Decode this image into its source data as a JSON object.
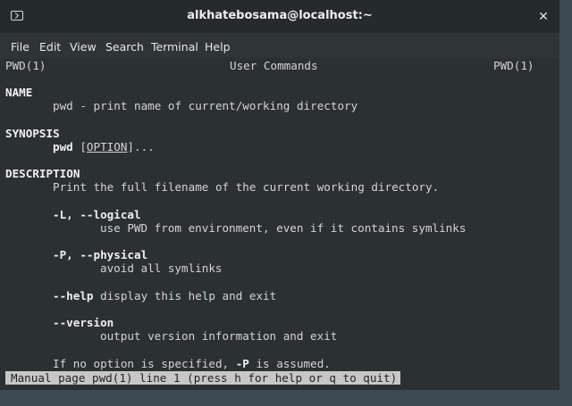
{
  "window": {
    "title": "alkhatebosama@localhost:~",
    "icon": "terminal-icon",
    "close_glyph": "✕"
  },
  "menu": [
    "File",
    "Edit",
    "View",
    "Search",
    "Terminal",
    "Help"
  ],
  "man": {
    "header_left": "PWD(1)",
    "header_center": "User Commands",
    "header_right": "PWD(1)",
    "name_heading": "NAME",
    "name_text": "pwd - print name of current/working directory",
    "synopsis_heading": "SYNOPSIS",
    "synopsis_cmd": "pwd",
    "synopsis_option": "OPTION",
    "description_heading": "DESCRIPTION",
    "description_text": "Print the full filename of the current working directory.",
    "opt_logical": "-L, --logical",
    "opt_logical_desc": "use PWD from environment, even if it contains symlinks",
    "opt_physical": "-P, --physical",
    "opt_physical_desc": "avoid all symlinks",
    "opt_help": "--help",
    "opt_help_desc": " display this help and exit",
    "opt_version": "--version",
    "opt_version_desc": "output version information and exit",
    "default_pre": "If no option is specified, ",
    "default_opt": "-P",
    "default_post": " is assumed."
  },
  "status_line": "Manual page pwd(1) line 1 (press h for help or q to quit)"
}
